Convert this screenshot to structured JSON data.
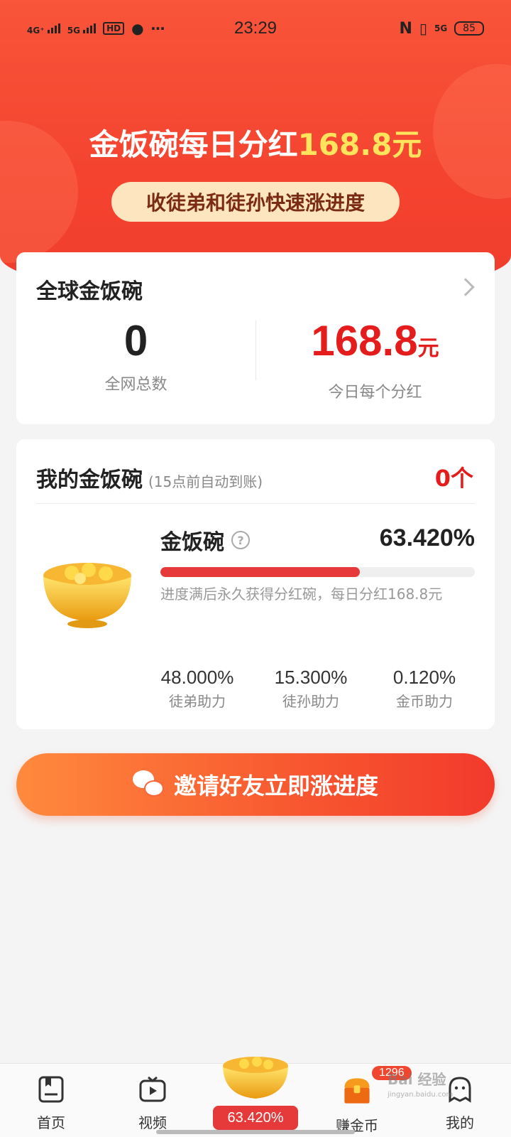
{
  "status_bar": {
    "time": "23:29",
    "network_1": "4G⁺",
    "network_2": "5G",
    "hd": "HD",
    "right_network": "5G",
    "battery": "85"
  },
  "hero": {
    "title": "金饭碗每日分红",
    "amount": "168.8元",
    "pill": "收徒弟和徒孙快速涨进度"
  },
  "global_card": {
    "title": "全球金饭碗",
    "total_count": "0",
    "total_label": "全网总数",
    "dividend_value": "168.8",
    "dividend_unit": "元",
    "dividend_label": "今日每个分红"
  },
  "my_card": {
    "title": "我的金饭碗",
    "note": "(15点前自动到账)",
    "count": "0个",
    "bowl_name": "金饭碗",
    "help": "?",
    "progress_text": "63.420%",
    "progress_fraction": 0.6342,
    "description": "进度满后永久获得分红碗，每日分红168.8元",
    "sub_stats": [
      {
        "value": "48.000%",
        "label": "徒弟助力"
      },
      {
        "value": "15.300%",
        "label": "徒孙助力"
      },
      {
        "value": "0.120%",
        "label": "金币助力"
      }
    ]
  },
  "invite_button": {
    "label": "邀请好友立即涨进度"
  },
  "tabbar": {
    "home": "首页",
    "video": "视频",
    "center_progress": "63.420%",
    "coins": "赚金币",
    "coins_badge": "1296",
    "mine": "我的"
  },
  "watermark": {
    "text": "Bai 经验",
    "sub": "jingyan.baidu.com"
  },
  "colors": {
    "hero_red": "#f4432f",
    "accent_red": "#e51c1c",
    "progress_red": "#e5393a",
    "pill_bg": "#fde5bf",
    "yellow": "#ffe45c"
  }
}
